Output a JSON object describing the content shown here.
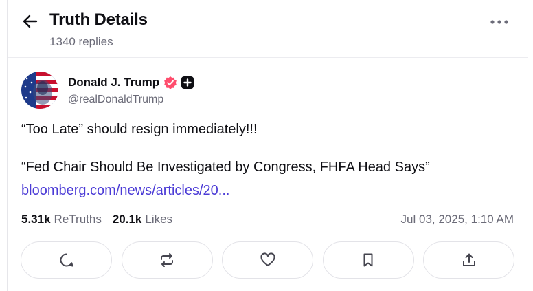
{
  "header": {
    "title": "Truth Details",
    "replies": "1340 replies",
    "back_icon": "arrow-left-icon",
    "more_icon": "more-horizontal-icon"
  },
  "post": {
    "author": {
      "display_name": "Donald J. Trump",
      "handle": "@realDonaldTrump",
      "verified_color": "#ff4d6d"
    },
    "text_line1": "“Too Late” should resign immediately!!!",
    "text_line2": "“Fed Chair Should Be Investigated by Congress, FHFA Head Says”",
    "link": "bloomberg.com/news/articles/20...",
    "link_color": "#4b3bd6",
    "stats": {
      "retruths_count": "5.31k",
      "retruths_label": "ReTruths",
      "likes_count": "20.1k",
      "likes_label": "Likes"
    },
    "timestamp": "Jul 03, 2025, 1:10 AM"
  },
  "actions": [
    {
      "icon": "reply-icon"
    },
    {
      "icon": "retruth-icon"
    },
    {
      "icon": "heart-icon"
    },
    {
      "icon": "bookmark-icon"
    },
    {
      "icon": "share-icon"
    }
  ]
}
